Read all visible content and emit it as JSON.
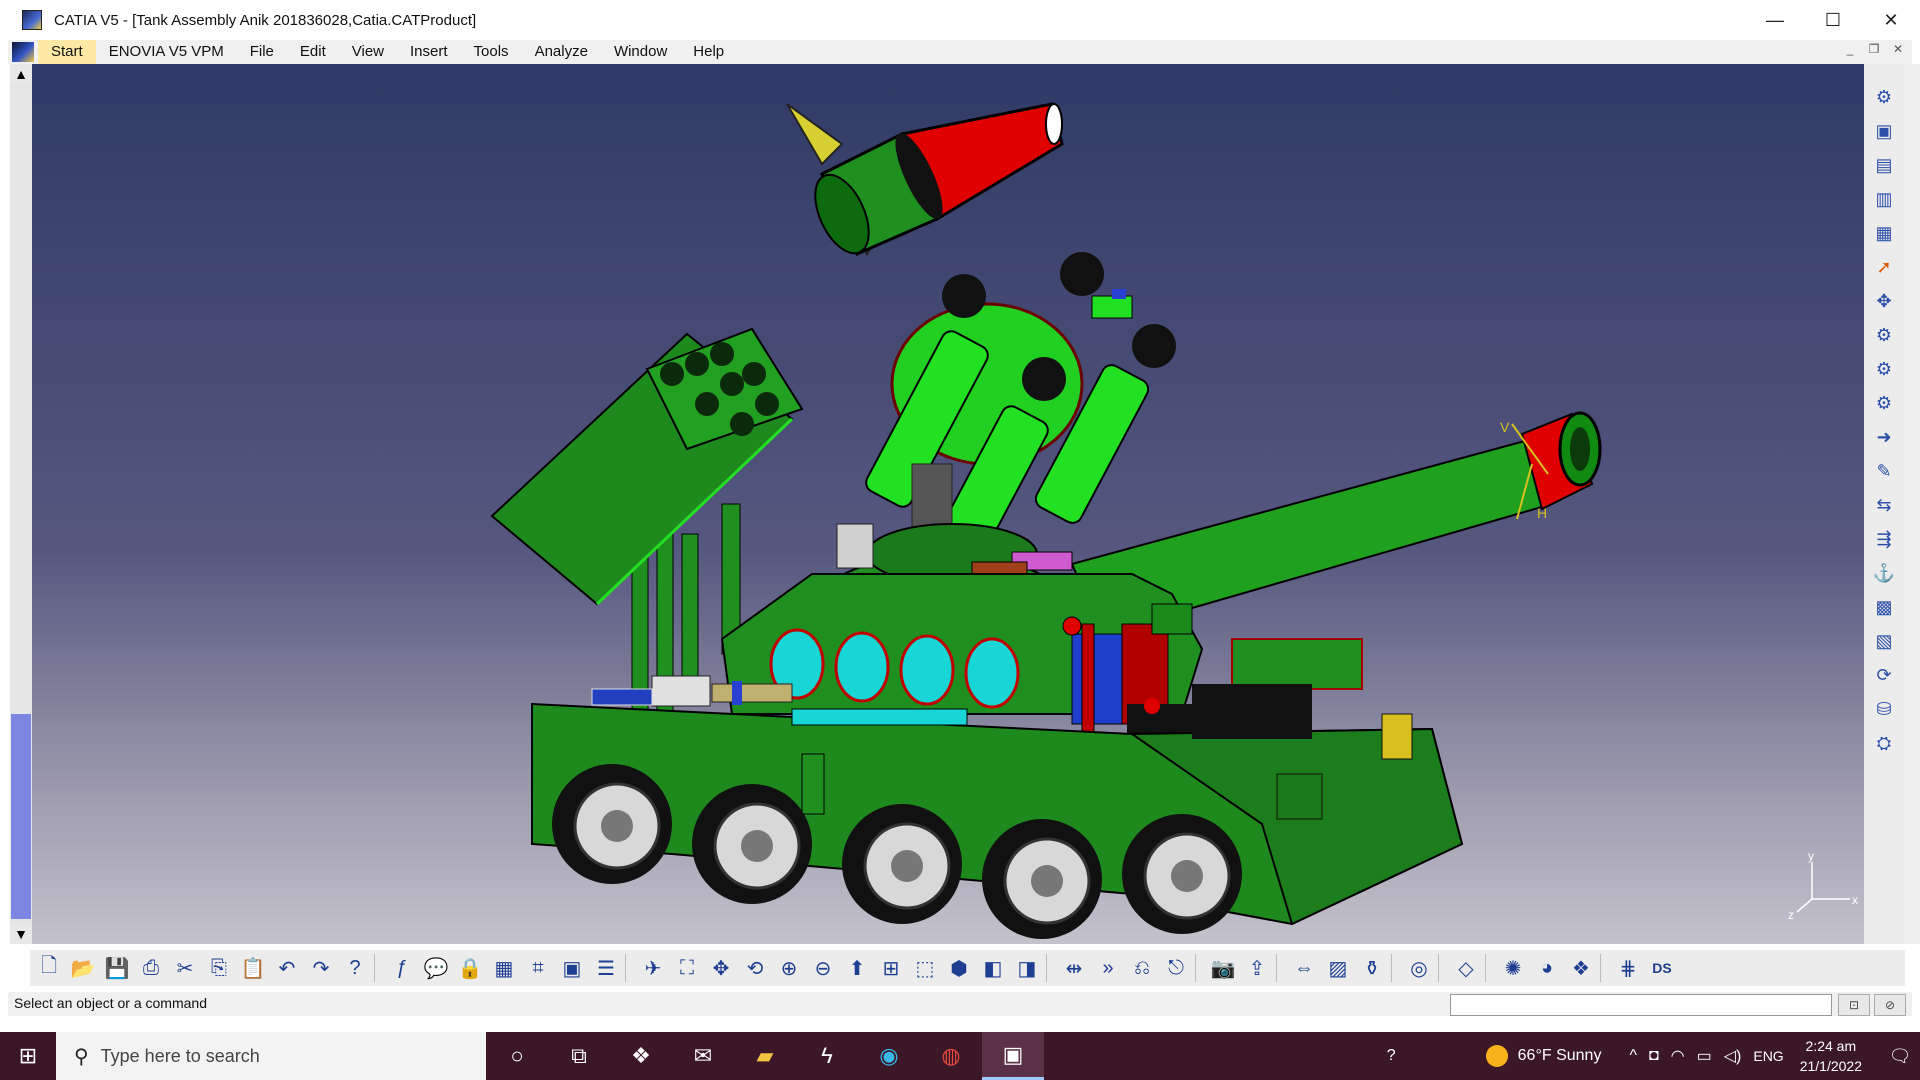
{
  "window": {
    "title": "CATIA V5 - [Tank Assembly Anik 201836028,Catia.CATProduct]",
    "minimize": "—",
    "maximize": "☐",
    "close": "✕"
  },
  "menubar": {
    "items": [
      {
        "label": "Start"
      },
      {
        "label": "ENOVIA V5 VPM"
      },
      {
        "label": "File"
      },
      {
        "label": "Edit"
      },
      {
        "label": "View"
      },
      {
        "label": "Insert"
      },
      {
        "label": "Tools"
      },
      {
        "label": "Analyze"
      },
      {
        "label": "Window"
      },
      {
        "label": "Help"
      }
    ]
  },
  "viewport": {
    "axis_labels": {
      "x": "x",
      "y": "y",
      "z": "z"
    },
    "compass_labels": {
      "v": "V",
      "h": "H"
    },
    "colors": {
      "bg_top": "#303a66",
      "bg_bottom": "#c4c2cc",
      "body_green": "#1f8f1f",
      "bright_green": "#22e022",
      "red": "#e30000",
      "cyan": "#19d6d6"
    }
  },
  "status": {
    "message": "Select an object or a command"
  },
  "taskbar": {
    "search_placeholder": "Type here to search",
    "weather": "66°F  Sunny",
    "language": "ENG",
    "time": "2:24 am",
    "date": "21/1/2022"
  }
}
